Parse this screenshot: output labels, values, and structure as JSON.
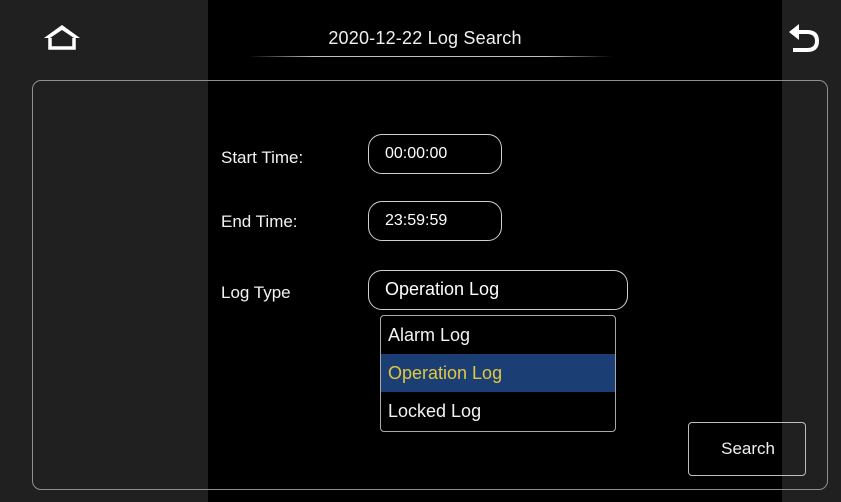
{
  "header": {
    "title": "2020-12-22 Log Search",
    "home_icon": "home-icon",
    "back_icon": "back-arrow-icon"
  },
  "form": {
    "start_time": {
      "label": "Start Time:",
      "value": "00:00:00"
    },
    "end_time": {
      "label": "End Time:",
      "value": "23:59:59"
    },
    "log_type": {
      "label": "Log Type",
      "value": "Operation Log",
      "options": [
        "Alarm Log",
        "Operation Log",
        "Locked Log"
      ],
      "selected_index": 1
    }
  },
  "search_button": {
    "label": "Search"
  },
  "colors": {
    "background_center": "#000000",
    "background_side": "#202020",
    "selected_option_bg": "#1b3f74",
    "selected_option_text": "#e2c742"
  }
}
